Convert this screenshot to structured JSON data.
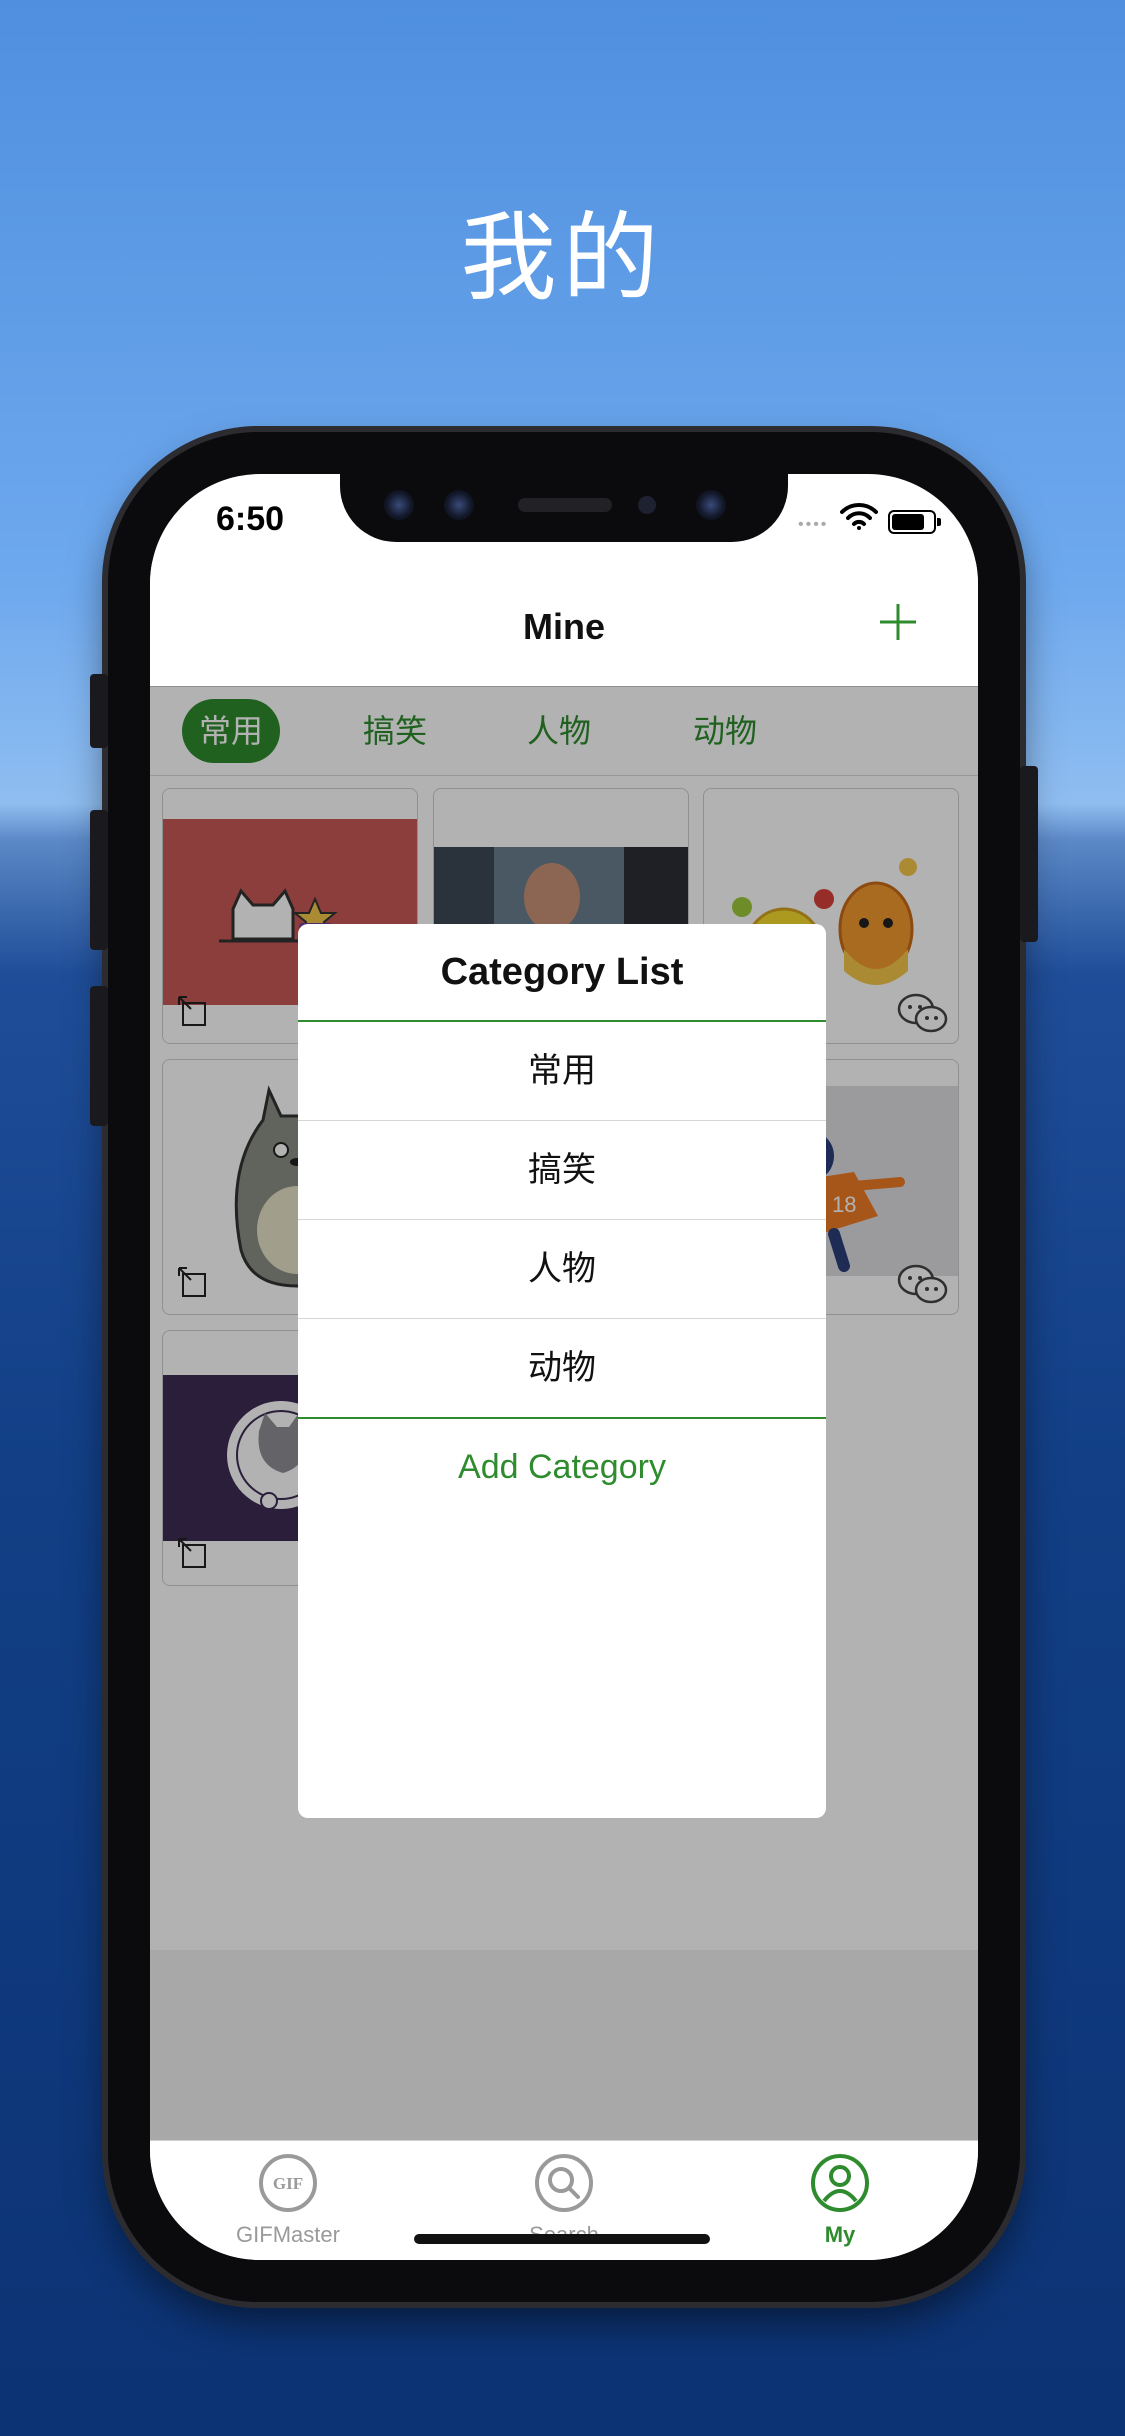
{
  "hero": {
    "title": "我的"
  },
  "status_bar": {
    "time": "6:50",
    "signal": "••••"
  },
  "navbar": {
    "title": "Mine",
    "add_icon": "plus-icon"
  },
  "categories": [
    {
      "label": "常用",
      "active": true
    },
    {
      "label": "搞笑",
      "active": false
    },
    {
      "label": "人物",
      "active": false
    },
    {
      "label": "动物",
      "active": false
    }
  ],
  "grid": {
    "items": [
      {
        "name": "cat-sticker",
        "badge": "external-link-icon"
      },
      {
        "name": "excited-man-gif",
        "badge": ""
      },
      {
        "name": "cute-mascots",
        "badge": "wechat-icon"
      },
      {
        "name": "totoro-sticker",
        "badge": "external-link-icon"
      },
      {
        "name": "football-player",
        "badge": "wechat-icon"
      },
      {
        "name": "cat-purple-sticker",
        "badge": "external-link-icon"
      }
    ]
  },
  "dialog": {
    "title": "Category List",
    "items": [
      "常用",
      "搞笑",
      "人物",
      "动物"
    ],
    "add_label": "Add Category"
  },
  "tabbar": {
    "tabs": [
      {
        "label": "GIFMaster",
        "icon": "gif-icon",
        "active": false
      },
      {
        "label": "Search",
        "icon": "search-icon",
        "active": false
      },
      {
        "label": "My",
        "icon": "user-icon",
        "active": true
      }
    ]
  },
  "colors": {
    "accent": "#2e8b2e",
    "inactive": "#9a9a9a"
  }
}
